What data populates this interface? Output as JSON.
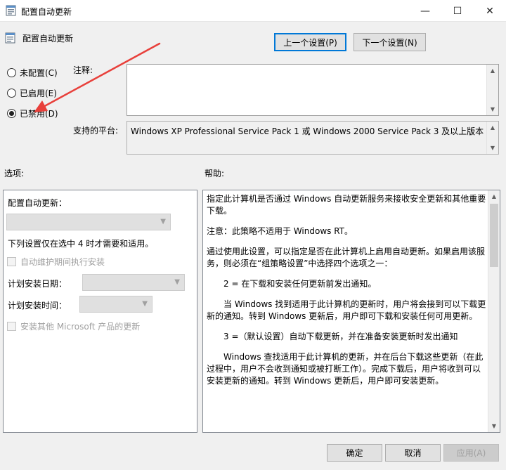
{
  "window": {
    "title": "配置自动更新",
    "min_glyph": "—",
    "max_glyph": "☐",
    "close_glyph": "✕"
  },
  "header": {
    "policy_name": "配置自动更新",
    "prev_button": "上一个设置(P)",
    "next_button": "下一个设置(N)"
  },
  "state": {
    "options": [
      {
        "label": "未配置(C)",
        "checked": false
      },
      {
        "label": "已启用(E)",
        "checked": false
      },
      {
        "label": "已禁用(D)",
        "checked": true
      }
    ]
  },
  "comment": {
    "label": "注释:",
    "value": ""
  },
  "platform": {
    "label": "支持的平台:",
    "value": "Windows XP Professional Service Pack 1 或 Windows 2000 Service Pack 3 及以上版本"
  },
  "sections": {
    "options_label": "选项:",
    "help_label": "帮助:"
  },
  "options_panel": {
    "configure_label": "配置自动更新：",
    "configure_value": "",
    "note": "下列设置仅在选中 4 时才需要和适用。",
    "maintenance_checkbox": "自动维护期间执行安装",
    "schedule_day_label": "计划安装日期：",
    "schedule_day_value": "",
    "schedule_time_label": "计划安装时间：",
    "schedule_time_value": "",
    "other_products_checkbox": "安装其他 Microsoft 产品的更新"
  },
  "help": {
    "p1": "指定此计算机是否通过 Windows 自动更新服务来接收安全更新和其他重要下载。",
    "p2": "注意：此策略不适用于 Windows RT。",
    "p3": "通过使用此设置，可以指定是否在此计算机上启用自动更新。如果启用该服务，则必须在“组策略设置”中选择四个选项之一：",
    "p4": "2 = 在下载和安装任何更新前发出通知。",
    "p5": "当 Windows 找到适用于此计算机的更新时，用户将会接到可以下载更新的通知。转到 Windows 更新后，用户即可下载和安装任何可用更新。",
    "p6": "3 =（默认设置）自动下载更新，并在准备安装更新时发出通知",
    "p7": "Windows 查找适用于此计算机的更新，并在后台下载这些更新（在此过程中，用户不会收到通知或被打断工作）。完成下载后，用户将收到可以安装更新的通知。转到 Windows 更新后，用户即可安装更新。"
  },
  "footer": {
    "ok_button": "确定",
    "cancel_button": "取消",
    "apply_button": "应用(A)"
  },
  "colors": {
    "accent": "#0078d7",
    "annotation_arrow": "#e8403b"
  }
}
